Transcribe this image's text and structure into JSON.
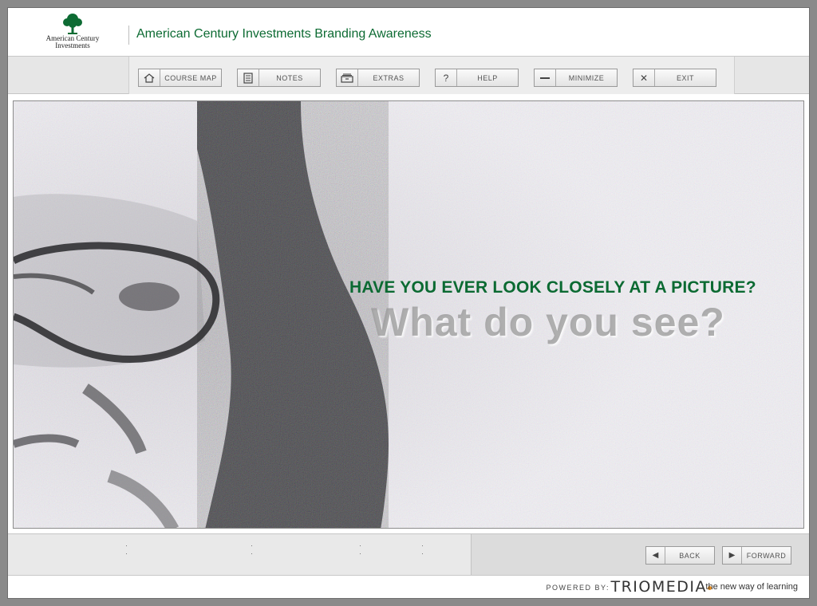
{
  "header": {
    "logo_text_line1": "American Century",
    "logo_text_line2": "Investments",
    "title": "American Century Investments Branding Awareness"
  },
  "toolbar": {
    "buttons": [
      {
        "label": "COURSE MAP",
        "icon": "home-icon"
      },
      {
        "label": "NOTES",
        "icon": "notes-icon"
      },
      {
        "label": "EXTRAS",
        "icon": "extras-icon"
      },
      {
        "label": "HELP",
        "icon": "help-icon"
      },
      {
        "label": "MINIMIZE",
        "icon": "minimize-icon"
      },
      {
        "label": "EXIT",
        "icon": "close-icon"
      }
    ]
  },
  "content": {
    "question": "HAVE YOU EVER LOOK CLOSELY AT A PICTURE?",
    "subquestion": "What do you see?"
  },
  "nav": {
    "back_label": "BACK",
    "forward_label": "FORWARD"
  },
  "credit": {
    "powered_by": "POWERED BY:",
    "brand": "TRIOMEDIA",
    "tagline": "the new way of learning"
  },
  "colors": {
    "brand_green": "#0b6a32",
    "accent_orange": "#e48a1c"
  }
}
